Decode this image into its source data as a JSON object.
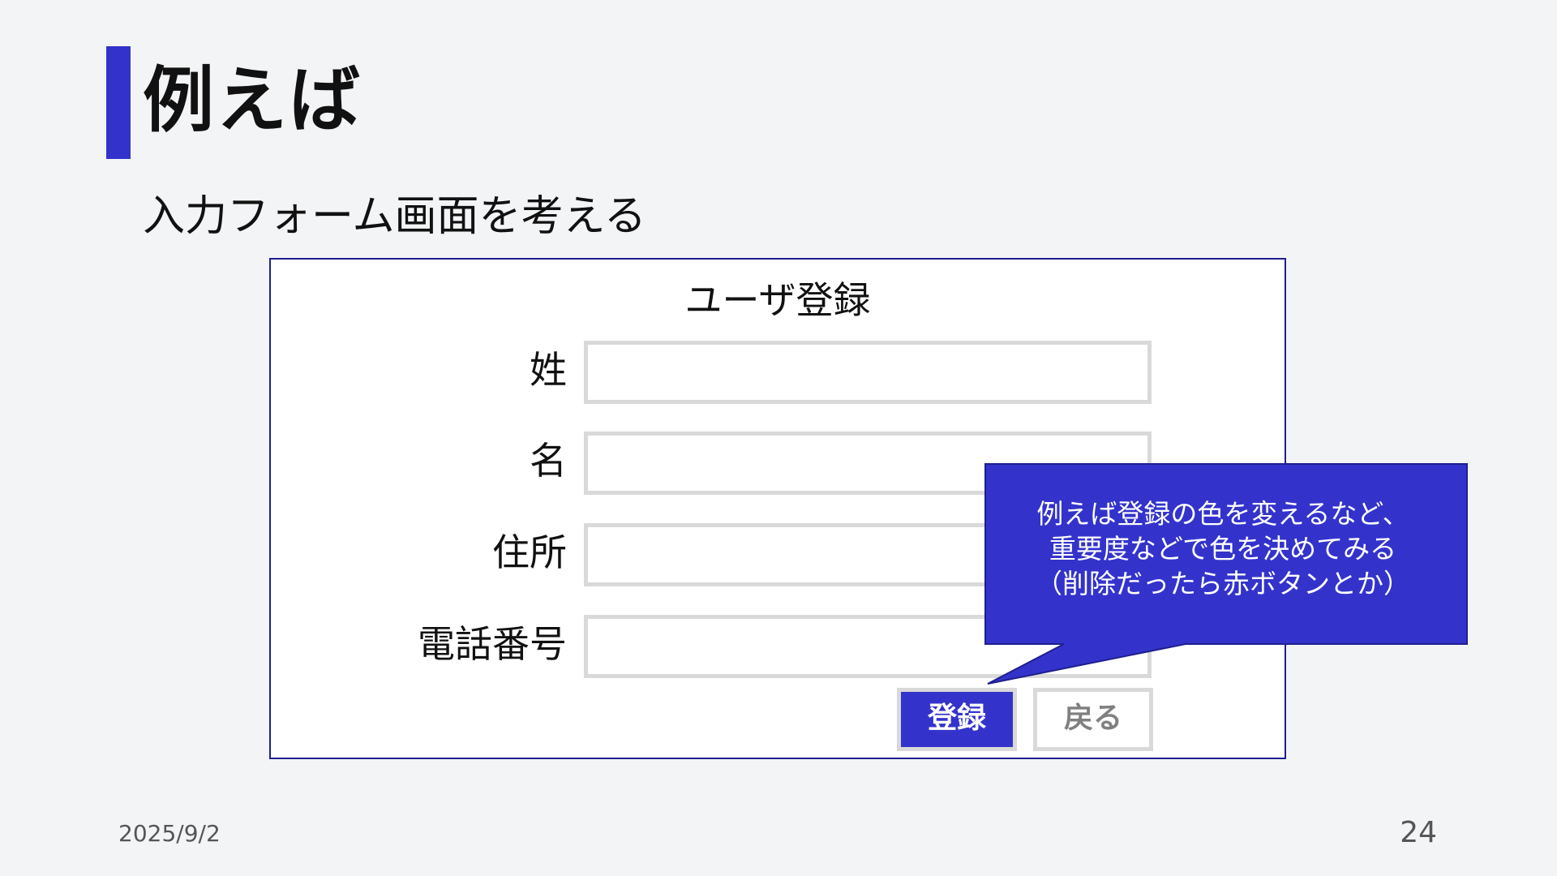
{
  "slide": {
    "title": "例えば",
    "subtitle": "入力フォーム画面を考える",
    "date": "2025/9/2",
    "page_number": "24"
  },
  "form": {
    "title": "ユーザ登録",
    "fields": [
      {
        "label": "姓",
        "value": ""
      },
      {
        "label": "名",
        "value": ""
      },
      {
        "label": "住所",
        "value": ""
      },
      {
        "label": "電話番号",
        "value": ""
      }
    ],
    "buttons": {
      "register_label": "登録",
      "back_label": "戻る"
    }
  },
  "callout": {
    "lines": [
      "例えば登録の色を変えるなど、",
      "重要度などで色を決めてみる",
      "（削除だったら赤ボタンとか）"
    ]
  },
  "colors": {
    "accent": "#3333cc",
    "form_border": "#1f1f8f",
    "input_border": "#d9d9d9",
    "background": "#f3f4f6"
  }
}
